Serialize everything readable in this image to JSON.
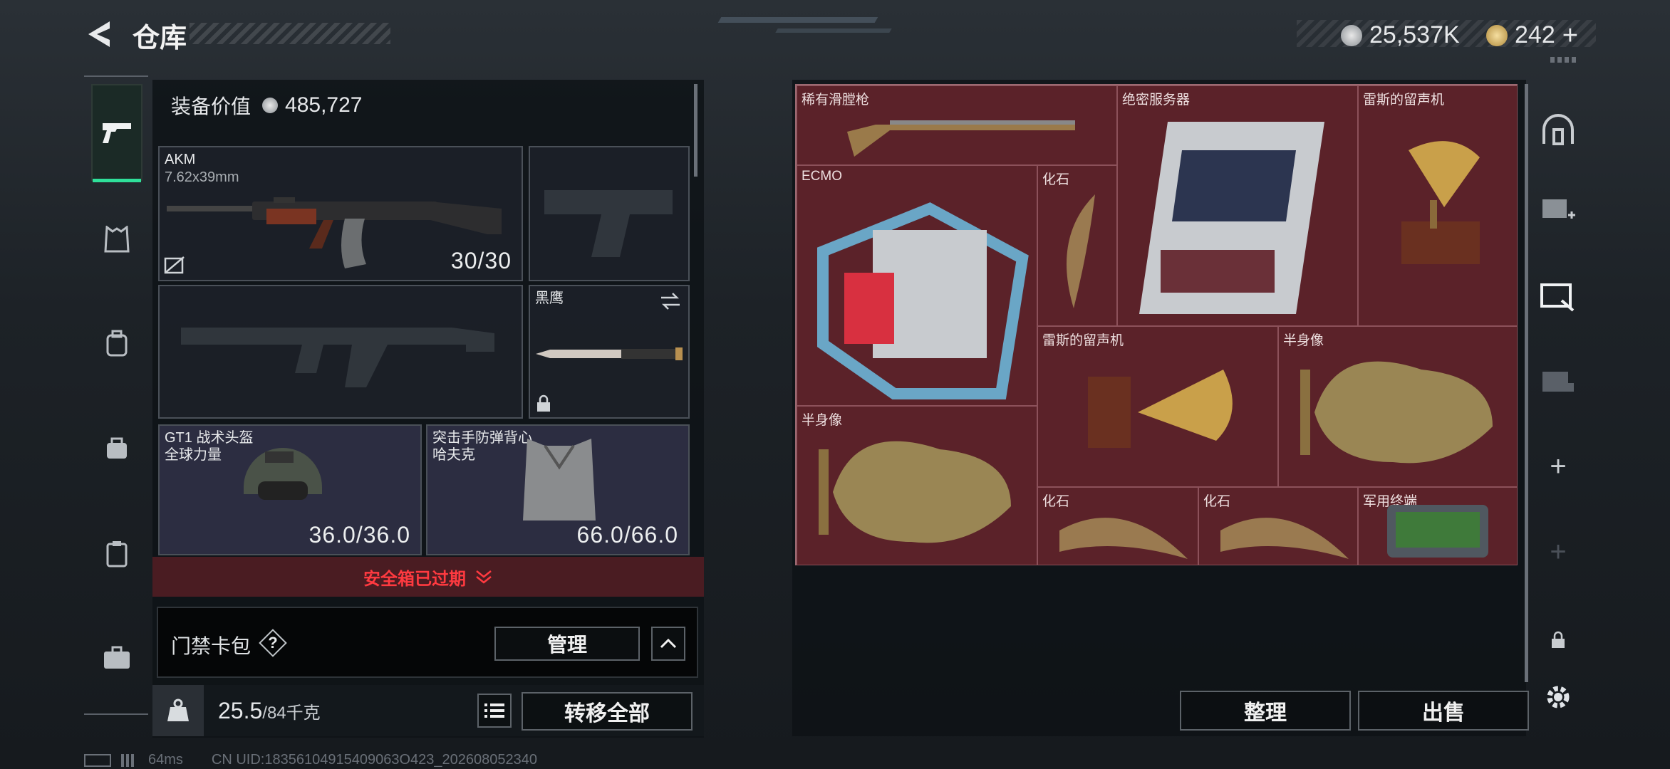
{
  "header": {
    "title": "仓库",
    "currency1": "25,537K",
    "currency2": "242"
  },
  "equipment": {
    "value_label": "装备价值",
    "value": "485,727"
  },
  "slots": {
    "primary": {
      "name": "AKM",
      "caliber": "7.62x39mm",
      "count": "30/30"
    },
    "melee": {
      "name": "黑鹰"
    },
    "helmet": {
      "name": "GT1 战术头盔",
      "sub": "全球力量",
      "durability": "36.0/36.0"
    },
    "armor": {
      "name": "突击手防弹背心",
      "sub": "哈夫克",
      "durability": "66.0/66.0"
    }
  },
  "safebox": {
    "text": "安全箱已过期"
  },
  "keycard": {
    "label": "门禁卡包",
    "help": "?",
    "manage": "管理"
  },
  "weight": {
    "current": "25.5",
    "max": "/84千克",
    "transfer_all": "转移全部"
  },
  "stash_items": [
    {
      "label": "稀有滑膛枪"
    },
    {
      "label": "绝密服务器"
    },
    {
      "label": "雷斯的留声机"
    },
    {
      "label": "ECMO"
    },
    {
      "label": "化石"
    },
    {
      "label": "雷斯的留声机"
    },
    {
      "label": "半身像"
    },
    {
      "label": "半身像"
    },
    {
      "label": "化石"
    },
    {
      "label": "化石"
    },
    {
      "label": "军用终端"
    }
  ],
  "actions": {
    "sort": "整理",
    "sell": "出售"
  },
  "status": {
    "ping": "64ms",
    "uid": "CN UID:18356104915409063O423_202608052340"
  },
  "colors": {
    "accent": "#2fe09a",
    "danger": "#e0303a",
    "stash_bg": "#5b2229"
  }
}
